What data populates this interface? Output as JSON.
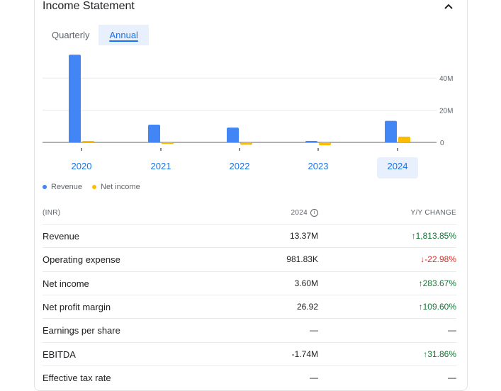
{
  "header": {
    "title": "Income Statement",
    "collapse_icon": "chevron-up-icon"
  },
  "tabs": [
    {
      "label": "Quarterly",
      "active": false
    },
    {
      "label": "Annual",
      "active": true
    }
  ],
  "chart_data": {
    "type": "bar",
    "categories": [
      "2020",
      "2021",
      "2022",
      "2023",
      "2024"
    ],
    "selected_category": "2024",
    "series": [
      {
        "name": "Revenue",
        "color": "#4285f4",
        "values": [
          54.5,
          11.0,
          9.2,
          0.7,
          13.37
        ]
      },
      {
        "name": "Net income",
        "color": "#fbbc04",
        "values": [
          0.3,
          -1.0,
          -1.5,
          -1.8,
          3.6
        ]
      }
    ],
    "y_ticks": [
      "0",
      "20M",
      "40M"
    ],
    "ylim": [
      -2,
      60
    ],
    "grid": true,
    "legend_position": "bottom-left"
  },
  "legend": [
    {
      "label": "Revenue",
      "color": "#4285f4"
    },
    {
      "label": "Net income",
      "color": "#fbbc04"
    }
  ],
  "table": {
    "headers": {
      "label": "(INR)",
      "value": "2024",
      "change": "Y/Y CHANGE"
    },
    "rows": [
      {
        "label": "Revenue",
        "value": "13.37M",
        "change": "1,813.85%",
        "direction": "up"
      },
      {
        "label": "Operating expense",
        "value": "981.83K",
        "change": "-22.98%",
        "direction": "down"
      },
      {
        "label": "Net income",
        "value": "3.60M",
        "change": "283.67%",
        "direction": "up"
      },
      {
        "label": "Net profit margin",
        "value": "26.92",
        "change": "109.60%",
        "direction": "up"
      },
      {
        "label": "Earnings per share",
        "value": "—",
        "change": "—",
        "direction": "none"
      },
      {
        "label": "EBITDA",
        "value": "-1.74M",
        "change": "31.86%",
        "direction": "up"
      },
      {
        "label": "Effective tax rate",
        "value": "—",
        "change": "—",
        "direction": "none"
      }
    ]
  }
}
